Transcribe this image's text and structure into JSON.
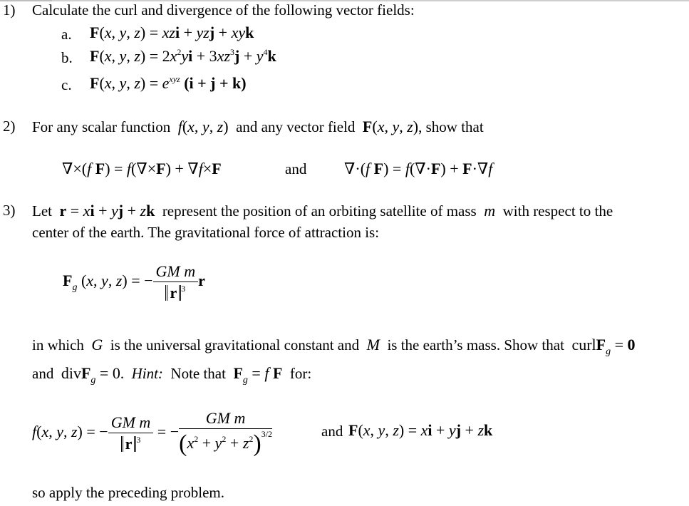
{
  "problems": [
    {
      "number": "1)",
      "intro": "Calculate the curl and divergence of the following vector fields:",
      "parts": [
        {
          "label": "a.",
          "lhs": "F(x, y, z) =",
          "rhs": "xzi + yzj + xyk"
        },
        {
          "label": "b.",
          "lhs": "F(x, y, z) =",
          "rhs": "2x²yi + 3xz³j + y⁴k"
        },
        {
          "label": "c.",
          "lhs": "F(x, y, z) =",
          "rhs": "e^{xyz}(i + j + k)"
        }
      ]
    },
    {
      "number": "2)",
      "intro_pre": "For any scalar function",
      "intro_f": "f(x, y, z)",
      "intro_mid": "and any vector field",
      "intro_F": "F(x, y, z)",
      "intro_post": ", show that",
      "identity_curl": "∇×(f F) = f(∇×F) + ∇f×F",
      "and_label": "and",
      "identity_div": "∇·(f F) = f(∇·F) + F·∇f"
    },
    {
      "number": "3)",
      "line1_pre": "Let",
      "line1_r": "r = xi + yj + zk",
      "line1_mid": "represent the position of an orbiting satellite of mass",
      "line1_m": "m",
      "line1_post": "with respect to the",
      "line2": "center of the earth.  The gravitational force of attraction is:",
      "force_lhs": "F_g(x, y, z) =",
      "force_numerator": "GM m",
      "force_denominator": "‖r‖³",
      "force_tail": "r",
      "line3_pre": "in which",
      "line3_G": "G",
      "line3_mid": "is the universal gravitational constant and",
      "line3_M": "M",
      "line3_post": "is the earth’s mass.  Show that",
      "line3_curl": "curl F_g = 0",
      "line4_pre": "and",
      "line4_div": "div F_g = 0",
      "line4_hint_label": "Hint:",
      "line4_hint": "Note that",
      "line4_eq": "F_g = f F",
      "line4_post": "for:",
      "f_lhs": "f(x, y, z) =",
      "f_numerator": "GM m",
      "f_denominator1": "‖r‖³",
      "f_denominator2": "(x² + y² + z²)^{3/2}",
      "f_and": "and",
      "F_def": "F(x, y, z) = xi + yj + zk",
      "closing": "so apply the preceding problem."
    }
  ]
}
